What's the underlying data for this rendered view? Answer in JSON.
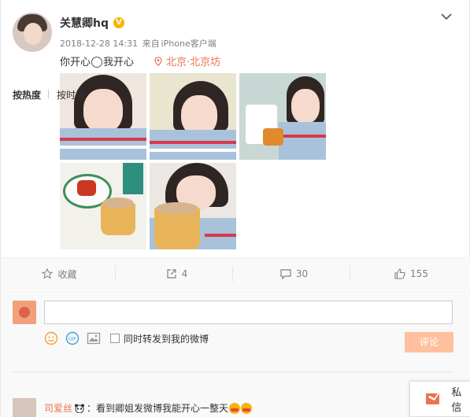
{
  "post": {
    "username": "关慧卿hq",
    "verified_badge": "V",
    "timestamp": "2018-12-28 14:31",
    "source_prefix": "来自",
    "source": "iPhone客户端",
    "text_before_emoji": "你开心",
    "text_after_emoji": "我开心",
    "location": "北京·北京坊",
    "photo_count": 5
  },
  "actions": {
    "favorite_label": "收藏",
    "share_count": "4",
    "comment_count": "30",
    "like_count": "155"
  },
  "compose": {
    "input_value": "",
    "repost_label": "同时转发到我的微博",
    "submit_label": "评论"
  },
  "sort": {
    "hot_label": "按热度",
    "time_label": "按时间"
  },
  "comments": [
    {
      "user": "司爱丝",
      "text": "：看到卿姐发微博我能开心一整天"
    }
  ],
  "private_message": {
    "label": "私信"
  },
  "colors": {
    "accent": "#eb7350",
    "verified": "#f7b500",
    "submit_disabled": "#ffc09f",
    "text_secondary": "#808080"
  }
}
